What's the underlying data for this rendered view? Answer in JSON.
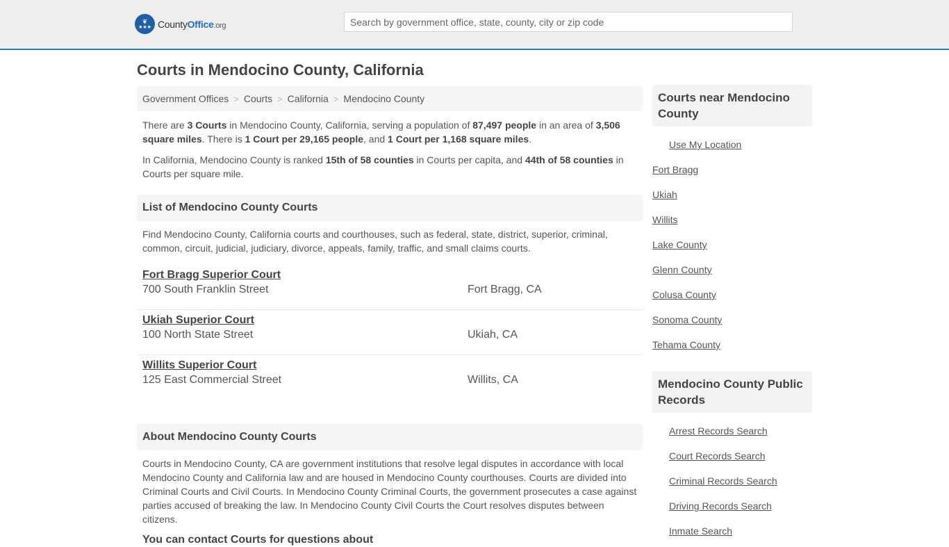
{
  "header": {
    "logo": {
      "county": "County",
      "office": "Office",
      "org": ".org"
    },
    "search": {
      "placeholder": "Search by government office, state, county, city or zip code",
      "value": ""
    }
  },
  "page_title": "Courts in Mendocino County, California",
  "breadcrumb": [
    "Government Offices",
    "Courts",
    "California",
    "Mendocino County"
  ],
  "breadcrumb_separator": ">",
  "summary": {
    "p1": {
      "t1": "There are ",
      "b1": "3 Courts",
      "t2": " in Mendocino County, California, serving a population of ",
      "b2": "87,497 people",
      "t3": " in an area of ",
      "b3": "3,506 square miles",
      "t4": ". There is ",
      "b4": "1 Court per 29,165 people",
      "t5": ", and ",
      "b5": "1 Court per 1,168 square miles",
      "t6": "."
    },
    "p2": {
      "t1": "In California, Mendocino County is ranked ",
      "b1": "15th of 58 counties",
      "t2": " in Courts per capita, and ",
      "b2": "44th of 58 counties",
      "t3": " in Courts per square mile."
    }
  },
  "list_section": {
    "heading": "List of Mendocino County Courts",
    "intro": "Find Mendocino County, California courts and courthouses, such as federal, state, district, superior, criminal, common, circuit, judicial, judiciary, divorce, appeals, family, traffic, and small claims courts.",
    "courts": [
      {
        "name": "Fort Bragg Superior Court",
        "address": "700 South Franklin Street",
        "city": "Fort Bragg, CA"
      },
      {
        "name": "Ukiah Superior Court",
        "address": "100 North State Street",
        "city": "Ukiah, CA"
      },
      {
        "name": "Willits Superior Court",
        "address": "125 East Commercial Street",
        "city": "Willits, CA"
      }
    ]
  },
  "about_section": {
    "heading": "About Mendocino County Courts",
    "text": "Courts in Mendocino County, CA are government institutions that resolve legal disputes in accordance with local Mendocino County and California law and are housed in Mendocino County courthouses. Courts are divided into Criminal Courts and Civil Courts. In Mendocino County Criminal Courts, the government prosecutes a case against parties accused of breaking the law. In Mendocino County Civil Courts the Court resolves disputes between citizens.",
    "next_heading_partial": "You can contact Courts for questions about"
  },
  "sidebar": {
    "nearby": {
      "heading": "Courts near Mendocino County",
      "use_location": "Use My Location",
      "links": [
        "Fort Bragg",
        "Ukiah",
        "Willits",
        "Lake County",
        "Glenn County",
        "Colusa County",
        "Sonoma County",
        "Tehama County"
      ]
    },
    "records": {
      "heading": "Mendocino County Public Records",
      "links": [
        "Arrest Records Search",
        "Court Records Search",
        "Criminal Records Search",
        "Driving Records Search",
        "Inmate Search"
      ]
    }
  },
  "colors": {
    "accent": "#2f7bbf",
    "logo_blue": "#1f5fa5",
    "header_bg": "#eeeeee",
    "panel_bg": "#f5f5f5"
  }
}
